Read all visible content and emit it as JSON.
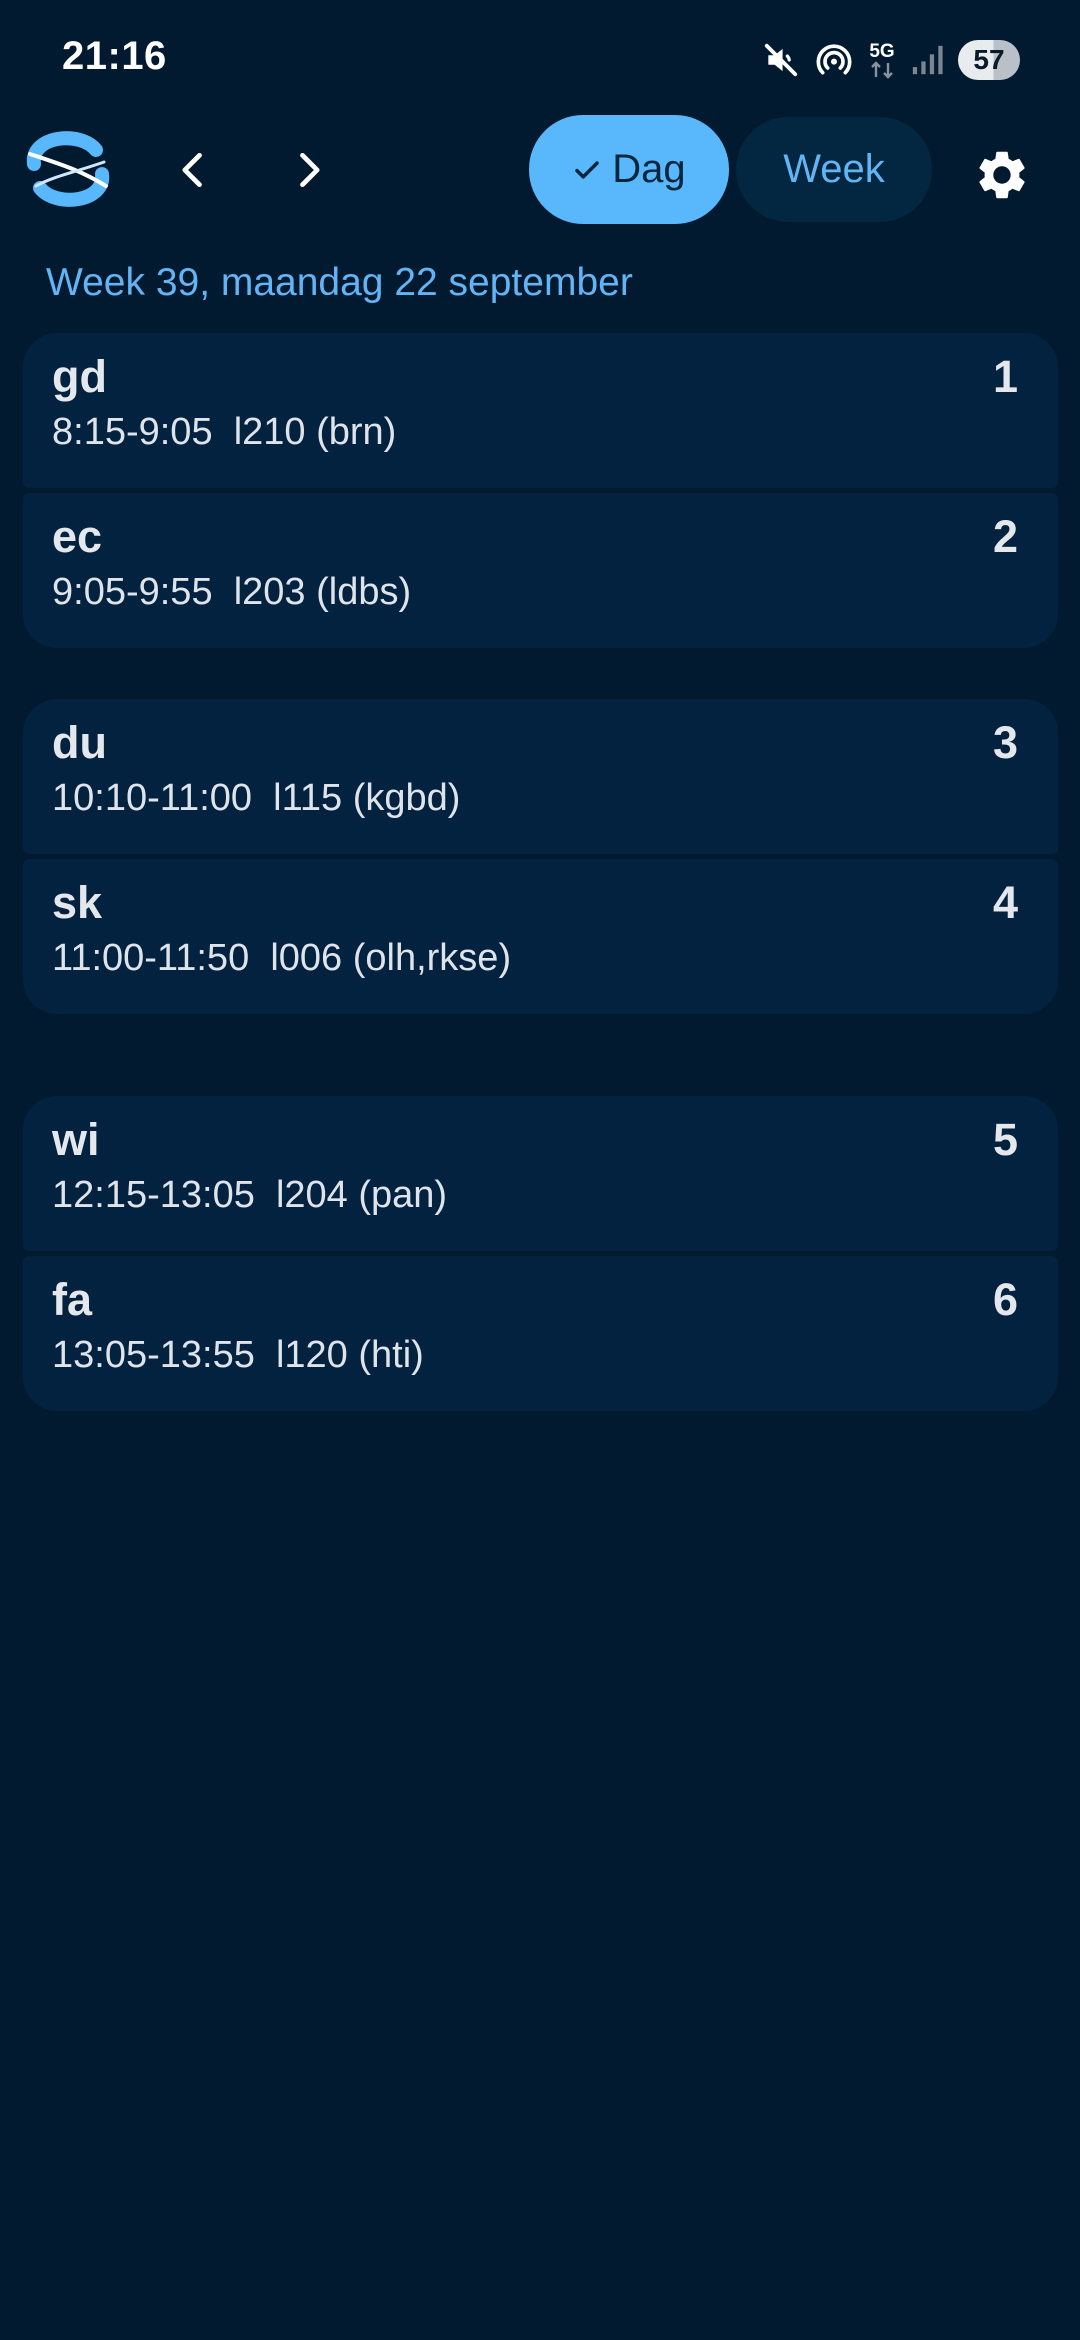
{
  "status_bar": {
    "time": "21:16",
    "network_label": "5G",
    "battery_level": "57",
    "icons": [
      "mute-icon",
      "hotspot-icon",
      "network-5g-icon",
      "signal-icon",
      "battery-icon"
    ]
  },
  "app_bar": {
    "logo": "app-logo",
    "prev_icon": "chevron-left-icon",
    "next_icon": "chevron-right-icon",
    "day_label": "Dag",
    "week_label": "Week",
    "day_selected": true,
    "settings_icon": "gear-icon"
  },
  "heading": "Week 39, maandag 22 september",
  "colors": {
    "background": "#011a2f",
    "card": "#03223f",
    "accent": "#59b7fb",
    "heading": "#63b4f4"
  },
  "lessons": [
    {
      "subject": "gd",
      "time": "8:15-9:05",
      "room": "l210 (brn)",
      "period": "1"
    },
    {
      "subject": "ec",
      "time": "9:05-9:55",
      "room": "l203 (ldbs)",
      "period": "2"
    },
    {
      "subject": "du",
      "time": "10:10-11:00",
      "room": "l115 (kgbd)",
      "period": "3"
    },
    {
      "subject": "sk",
      "time": "11:00-11:50",
      "room": "l006 (olh,rkse)",
      "period": "4"
    },
    {
      "subject": "wi",
      "time": "12:15-13:05",
      "room": "l204 (pan)",
      "period": "5"
    },
    {
      "subject": "fa",
      "time": "13:05-13:55",
      "room": "l120 (hti)",
      "period": "6"
    }
  ]
}
